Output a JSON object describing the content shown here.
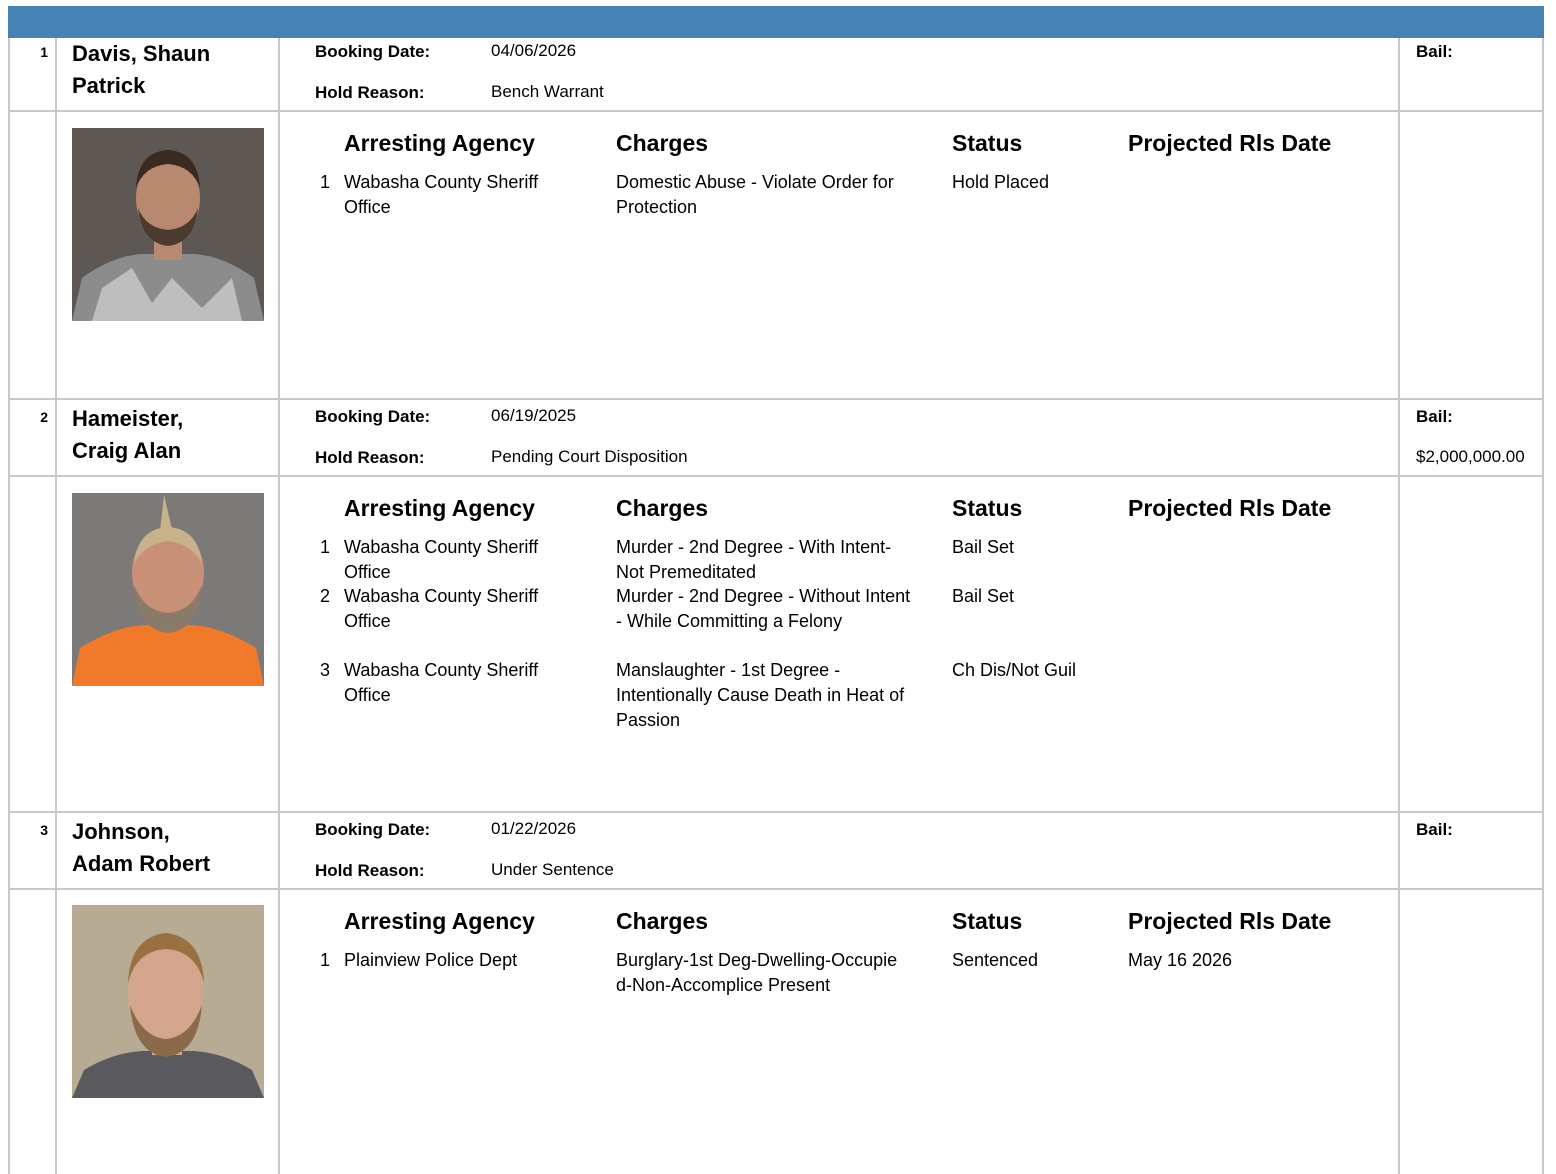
{
  "column_headers": {
    "agency": "Arresting Agency",
    "charges": "Charges",
    "status": "Status",
    "release": "Projected Rls Date"
  },
  "labels": {
    "booking": "Booking Date:",
    "hold": "Hold Reason:",
    "bail": "Bail:"
  },
  "inmates": [
    {
      "number": "1",
      "name": "Davis, Shaun Patrick",
      "booking_date": "04/06/2026",
      "hold_reason": "Bench Warrant",
      "bail": "",
      "photo": {
        "bg": "#5d5853",
        "shirt": "#8c8c8c",
        "skin": "#b8896e",
        "hair": "#3a2a20",
        "beard": "#4a3a30"
      },
      "charges": [
        {
          "idx": "1",
          "agency": "Wabasha County Sheriff Office",
          "charge": "Domestic Abuse - Violate Order for Protection",
          "status": "Hold Placed",
          "release": ""
        }
      ]
    },
    {
      "number": "2",
      "name": "Hameister, Craig Alan",
      "booking_date": "06/19/2025",
      "hold_reason": "Pending Court Disposition",
      "bail": "$2,000,000.00",
      "photo": {
        "bg": "#7b7a78",
        "shirt": "#f07a2a",
        "skin": "#c99078",
        "hair": "#c8b28a",
        "beard": "#8a7a6a"
      },
      "charges": [
        {
          "idx": "1",
          "agency": "Wabasha County Sheriff Office",
          "charge": "Murder - 2nd Degree - With Intent-Not Premeditated",
          "status": "Bail Set",
          "release": ""
        },
        {
          "idx": "2",
          "agency": "Wabasha County Sheriff Office",
          "charge": "Murder - 2nd Degree - Without Intent - While Committing a Felony",
          "status": "Bail Set",
          "release": ""
        },
        {
          "idx": "3",
          "agency": "Wabasha County Sheriff Office",
          "charge": "Manslaughter - 1st Degree - Intentionally Cause Death in Heat of Passion",
          "status": "Ch Dis/Not Guil",
          "release": ""
        }
      ]
    },
    {
      "number": "3",
      "name": "Johnson, Adam Robert",
      "booking_date": "01/22/2026",
      "hold_reason": "Under Sentence",
      "bail": "",
      "photo": {
        "bg": "#b8ab93",
        "shirt": "#5a5a5e",
        "skin": "#d2a58c",
        "hair": "#9a7040",
        "beard": "#8a6a48"
      },
      "charges": [
        {
          "idx": "1",
          "agency": "Plainview Police Dept",
          "charge": "Burglary-1st Deg-Dwelling-Occupied-Non-Accomplice Present",
          "status": "Sentenced",
          "release": "May 16 2026"
        }
      ]
    }
  ]
}
